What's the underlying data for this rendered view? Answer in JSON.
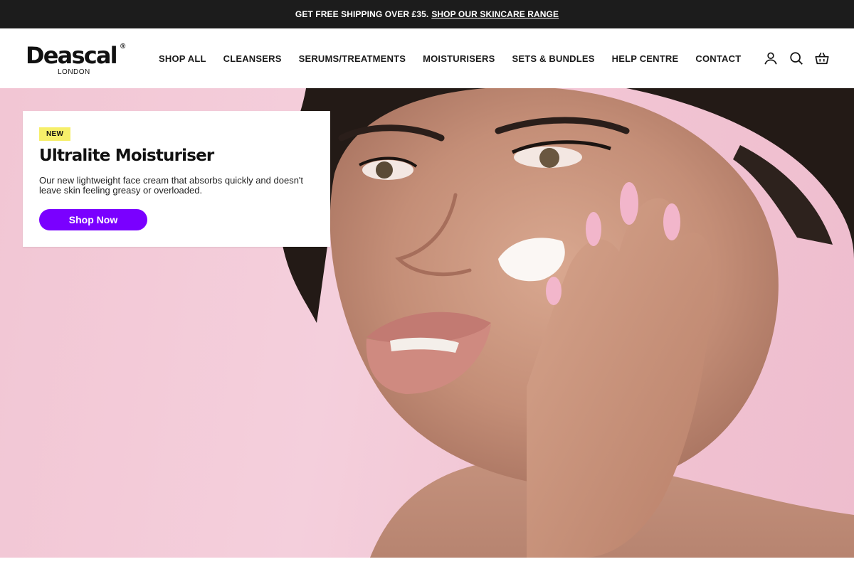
{
  "announcement": {
    "text": "GET FREE SHIPPING OVER £35.",
    "link_label": "SHOP OUR SKINCARE RANGE"
  },
  "brand": {
    "name": "Deascal",
    "registered": "®",
    "location": "LONDON"
  },
  "nav": {
    "items": [
      {
        "label": "SHOP ALL"
      },
      {
        "label": "CLEANSERS"
      },
      {
        "label": "SERUMS/TREATMENTS"
      },
      {
        "label": "MOISTURISERS"
      },
      {
        "label": "SETS & BUNDLES"
      },
      {
        "label": "HELP CENTRE"
      },
      {
        "label": "CONTACT"
      }
    ]
  },
  "header_icons": [
    "account-icon",
    "search-icon",
    "cart-icon"
  ],
  "hero": {
    "badge": "NEW",
    "title": "Ultralite Moisturiser",
    "description": "Our new lightweight face cream that absorbs quickly and doesn't leave skin feeling greasy or overloaded.",
    "cta_label": "Shop Now"
  },
  "colors": {
    "announcement_bg": "#1c1c1c",
    "cta": "#7a00ff",
    "badge": "#f6ef6a",
    "hero_bg": "#f4cfdc"
  }
}
